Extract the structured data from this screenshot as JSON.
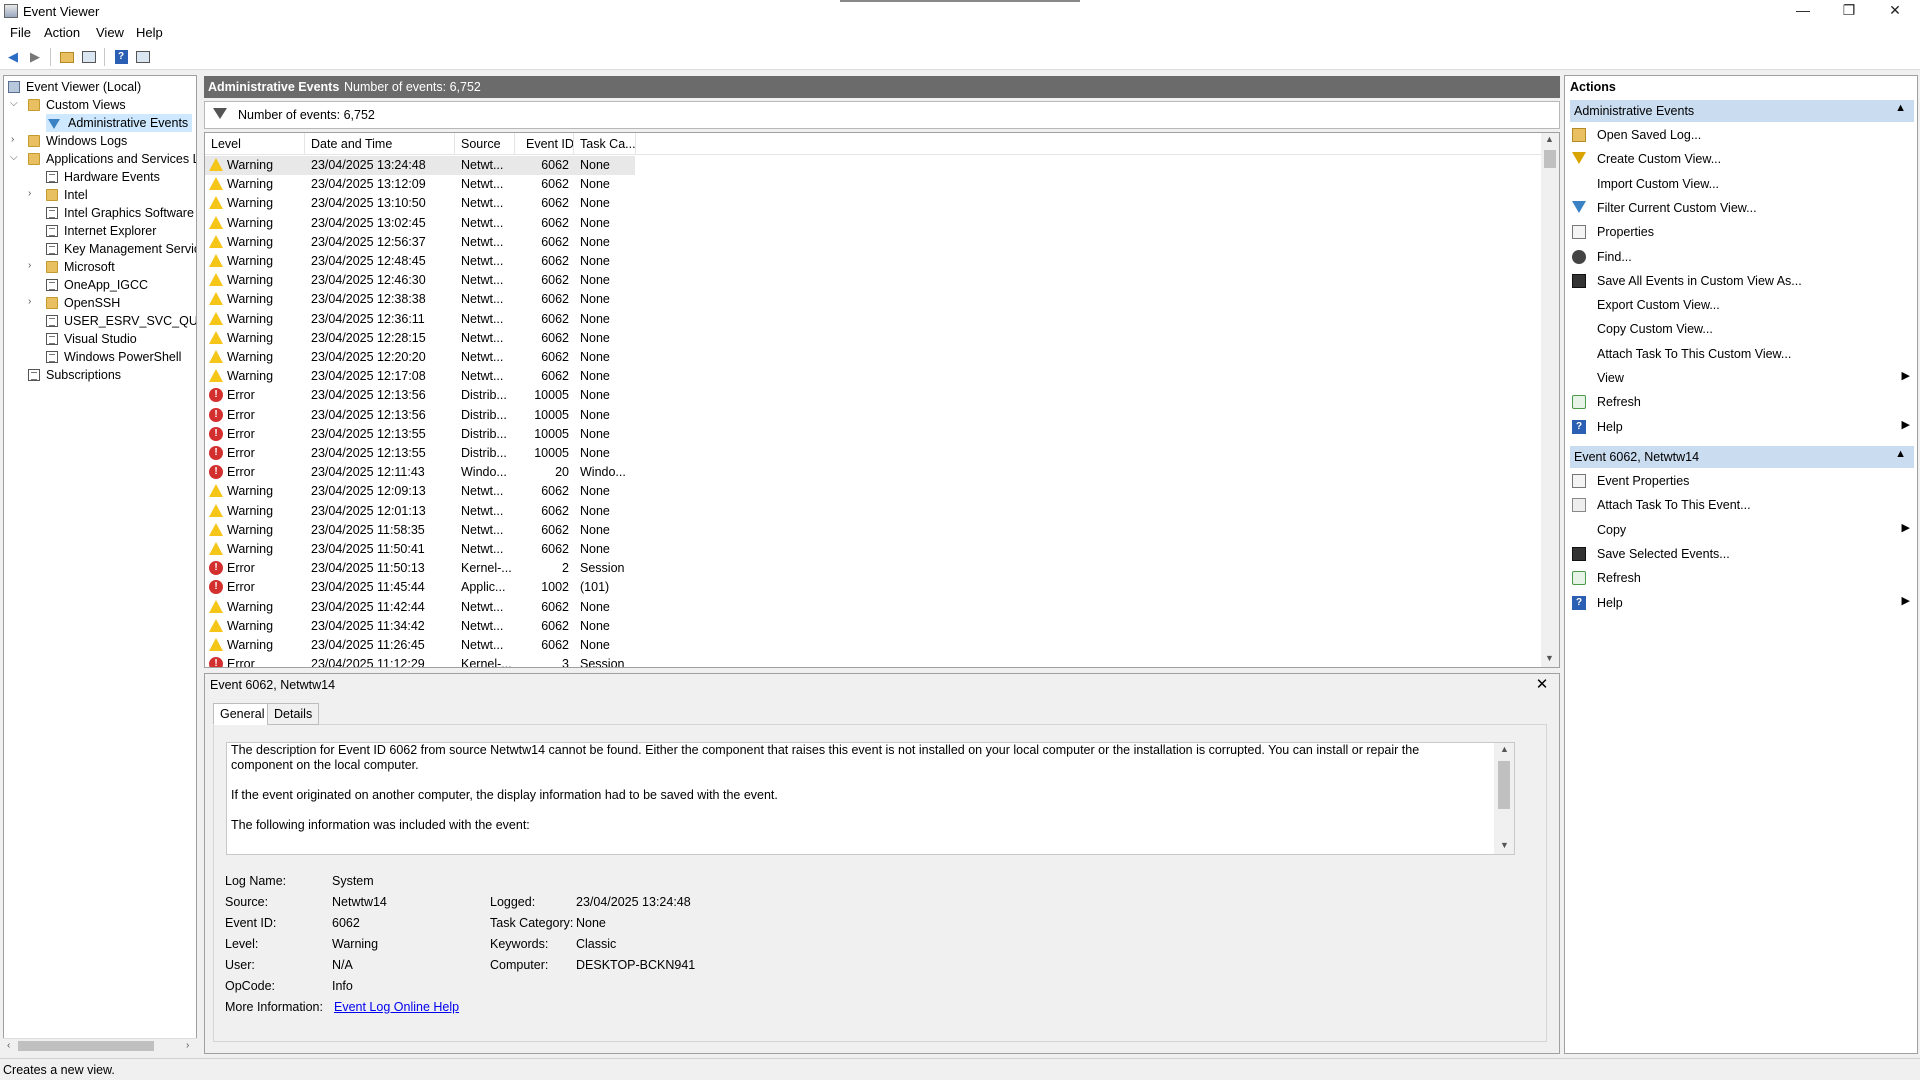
{
  "window": {
    "title": "Event Viewer",
    "minimize": "—",
    "restore": "❐",
    "close": "✕"
  },
  "menu": [
    "File",
    "Action",
    "View",
    "Help"
  ],
  "tree": {
    "root": "Event Viewer (Local)",
    "custom_views": "Custom Views",
    "admin_events": "Administrative Events",
    "windows_logs": "Windows Logs",
    "apps_services": "Applications and Services Lo",
    "children": [
      {
        "label": "Hardware Events",
        "kind": "log",
        "expandable": false
      },
      {
        "label": "Intel",
        "kind": "folder",
        "expandable": true
      },
      {
        "label": "Intel Graphics Software",
        "kind": "log",
        "expandable": false
      },
      {
        "label": "Internet Explorer",
        "kind": "log",
        "expandable": false
      },
      {
        "label": "Key Management Service",
        "kind": "log",
        "expandable": false
      },
      {
        "label": "Microsoft",
        "kind": "folder",
        "expandable": true
      },
      {
        "label": "OneApp_IGCC",
        "kind": "log",
        "expandable": false
      },
      {
        "label": "OpenSSH",
        "kind": "folder",
        "expandable": true
      },
      {
        "label": "USER_ESRV_SVC_QUEENC",
        "kind": "log",
        "expandable": false
      },
      {
        "label": "Visual Studio",
        "kind": "log",
        "expandable": false
      },
      {
        "label": "Windows PowerShell",
        "kind": "log",
        "expandable": false
      }
    ],
    "subscriptions": "Subscriptions"
  },
  "center": {
    "header_title": "Administrative Events",
    "header_count": "Number of events: 6,752",
    "filter_count": "Number of events: 6,752",
    "columns": [
      "Level",
      "Date and Time",
      "Source",
      "Event ID",
      "Task Ca..."
    ],
    "rows": [
      {
        "level": "Warning",
        "date": "23/04/2025 13:24:48",
        "source": "Netwt...",
        "id": "6062",
        "task": "None"
      },
      {
        "level": "Warning",
        "date": "23/04/2025 13:12:09",
        "source": "Netwt...",
        "id": "6062",
        "task": "None"
      },
      {
        "level": "Warning",
        "date": "23/04/2025 13:10:50",
        "source": "Netwt...",
        "id": "6062",
        "task": "None"
      },
      {
        "level": "Warning",
        "date": "23/04/2025 13:02:45",
        "source": "Netwt...",
        "id": "6062",
        "task": "None"
      },
      {
        "level": "Warning",
        "date": "23/04/2025 12:56:37",
        "source": "Netwt...",
        "id": "6062",
        "task": "None"
      },
      {
        "level": "Warning",
        "date": "23/04/2025 12:48:45",
        "source": "Netwt...",
        "id": "6062",
        "task": "None"
      },
      {
        "level": "Warning",
        "date": "23/04/2025 12:46:30",
        "source": "Netwt...",
        "id": "6062",
        "task": "None"
      },
      {
        "level": "Warning",
        "date": "23/04/2025 12:38:38",
        "source": "Netwt...",
        "id": "6062",
        "task": "None"
      },
      {
        "level": "Warning",
        "date": "23/04/2025 12:36:11",
        "source": "Netwt...",
        "id": "6062",
        "task": "None"
      },
      {
        "level": "Warning",
        "date": "23/04/2025 12:28:15",
        "source": "Netwt...",
        "id": "6062",
        "task": "None"
      },
      {
        "level": "Warning",
        "date": "23/04/2025 12:20:20",
        "source": "Netwt...",
        "id": "6062",
        "task": "None"
      },
      {
        "level": "Warning",
        "date": "23/04/2025 12:17:08",
        "source": "Netwt...",
        "id": "6062",
        "task": "None"
      },
      {
        "level": "Error",
        "date": "23/04/2025 12:13:56",
        "source": "Distrib...",
        "id": "10005",
        "task": "None"
      },
      {
        "level": "Error",
        "date": "23/04/2025 12:13:56",
        "source": "Distrib...",
        "id": "10005",
        "task": "None"
      },
      {
        "level": "Error",
        "date": "23/04/2025 12:13:55",
        "source": "Distrib...",
        "id": "10005",
        "task": "None"
      },
      {
        "level": "Error",
        "date": "23/04/2025 12:13:55",
        "source": "Distrib...",
        "id": "10005",
        "task": "None"
      },
      {
        "level": "Error",
        "date": "23/04/2025 12:11:43",
        "source": "Windo...",
        "id": "20",
        "task": "Windo..."
      },
      {
        "level": "Warning",
        "date": "23/04/2025 12:09:13",
        "source": "Netwt...",
        "id": "6062",
        "task": "None"
      },
      {
        "level": "Warning",
        "date": "23/04/2025 12:01:13",
        "source": "Netwt...",
        "id": "6062",
        "task": "None"
      },
      {
        "level": "Warning",
        "date": "23/04/2025 11:58:35",
        "source": "Netwt...",
        "id": "6062",
        "task": "None"
      },
      {
        "level": "Warning",
        "date": "23/04/2025 11:50:41",
        "source": "Netwt...",
        "id": "6062",
        "task": "None"
      },
      {
        "level": "Error",
        "date": "23/04/2025 11:50:13",
        "source": "Kernel-...",
        "id": "2",
        "task": "Session"
      },
      {
        "level": "Error",
        "date": "23/04/2025 11:45:44",
        "source": "Applic...",
        "id": "1002",
        "task": "(101)"
      },
      {
        "level": "Warning",
        "date": "23/04/2025 11:42:44",
        "source": "Netwt...",
        "id": "6062",
        "task": "None"
      },
      {
        "level": "Warning",
        "date": "23/04/2025 11:34:42",
        "source": "Netwt...",
        "id": "6062",
        "task": "None"
      },
      {
        "level": "Warning",
        "date": "23/04/2025 11:26:45",
        "source": "Netwt...",
        "id": "6062",
        "task": "None"
      },
      {
        "level": "Error",
        "date": "23/04/2025 11:12:29",
        "source": "Kernel-...",
        "id": "3",
        "task": "Session"
      }
    ]
  },
  "detail": {
    "title": "Event 6062, Netwtw14",
    "tabs": [
      "General",
      "Details"
    ],
    "description": [
      "The description for Event ID 6062 from source Netwtw14 cannot be found. Either the component that raises this event is not installed on your local computer or the installation is corrupted. You can install or repair the component on the local computer.",
      "If the event originated on another computer, the display information had to be saved with the event.",
      "The following information was included with the event:"
    ],
    "props": {
      "log_name_label": "Log Name:",
      "log_name": "System",
      "source_label": "Source:",
      "source": "Netwtw14",
      "logged_label": "Logged:",
      "logged": "23/04/2025 13:24:48",
      "event_id_label": "Event ID:",
      "event_id": "6062",
      "task_category_label": "Task Category:",
      "task_category": "None",
      "level_label": "Level:",
      "level": "Warning",
      "keywords_label": "Keywords:",
      "keywords": "Classic",
      "user_label": "User:",
      "user": "N/A",
      "computer_label": "Computer:",
      "computer": "DESKTOP-BCKN941",
      "opcode_label": "OpCode:",
      "opcode": "Info",
      "more_info_label": "More Information:",
      "more_info_link": "Event Log Online Help"
    }
  },
  "actions": {
    "title": "Actions",
    "section1": "Administrative Events",
    "items1": [
      {
        "label": "Open Saved Log...",
        "icon": "open-log-icon",
        "arrow": false
      },
      {
        "label": "Create Custom View...",
        "icon": "create-view-icon",
        "arrow": false
      },
      {
        "label": "Import Custom View...",
        "icon": "",
        "arrow": false
      },
      {
        "label": "Filter Current Custom View...",
        "icon": "filter-icon",
        "arrow": false
      },
      {
        "label": "Properties",
        "icon": "properties-icon",
        "arrow": false
      },
      {
        "label": "Find...",
        "icon": "find-icon",
        "arrow": false
      },
      {
        "label": "Save All Events in Custom View As...",
        "icon": "save-icon",
        "arrow": false
      },
      {
        "label": "Export Custom View...",
        "icon": "",
        "arrow": false
      },
      {
        "label": "Copy Custom View...",
        "icon": "",
        "arrow": false
      },
      {
        "label": "Attach Task To This Custom View...",
        "icon": "",
        "arrow": false
      },
      {
        "label": "View",
        "icon": "",
        "arrow": true
      },
      {
        "label": "Refresh",
        "icon": "refresh-icon",
        "arrow": false
      },
      {
        "label": "Help",
        "icon": "help-icon",
        "arrow": true
      }
    ],
    "section2": "Event 6062, Netwtw14",
    "items2": [
      {
        "label": "Event Properties",
        "icon": "properties-icon",
        "arrow": false
      },
      {
        "label": "Attach Task To This Event...",
        "icon": "attach-task-icon",
        "arrow": false
      },
      {
        "label": "Copy",
        "icon": "copy-icon",
        "arrow": true
      },
      {
        "label": "Save Selected Events...",
        "icon": "save-icon",
        "arrow": false
      },
      {
        "label": "Refresh",
        "icon": "refresh-icon",
        "arrow": false
      },
      {
        "label": "Help",
        "icon": "help-icon",
        "arrow": true
      }
    ]
  },
  "status": "Creates a new view.",
  "colors": {
    "header_bg": "#6b6b6b",
    "action_section_bg": "#c9dcf0",
    "warning": "#f5c518",
    "error": "#d32f2f",
    "selection": "#cde8ff"
  }
}
